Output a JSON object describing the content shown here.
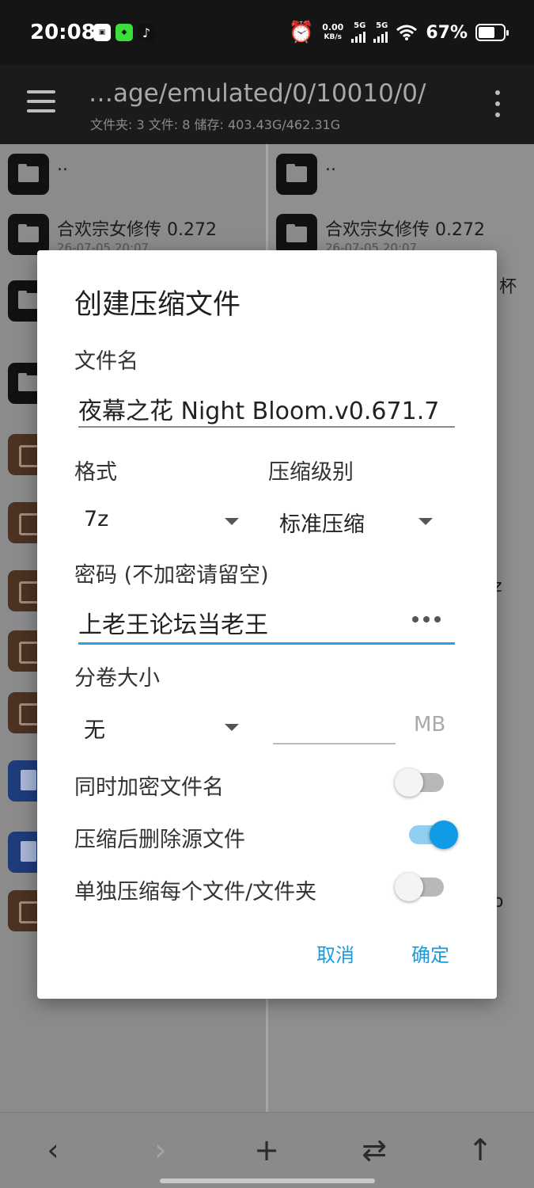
{
  "status_bar": {
    "time": "20:08",
    "app_icons": [
      "app-icon-1",
      "app-icon-2",
      "tiktok-icon"
    ],
    "net_speed_value": "0.00",
    "net_speed_unit": "KB/s",
    "signal_1": "5G",
    "signal_2": "5G",
    "battery": "67%",
    "battery_level": 0.67
  },
  "toolbar": {
    "path": "…age/emulated/0/10010/0/",
    "summary": "文件夹: 3  文件: 8  储存: 403.43G/462.31G"
  },
  "left_pane": {
    "items": [
      {
        "type": "folder",
        "name": "..",
        "date": ""
      },
      {
        "type": "folder",
        "name": "合欢宗女修传 0.272",
        "date": "26-07-05 20:07"
      },
      {
        "type": "folder",
        "name": "",
        "date": ""
      },
      {
        "type": "folder",
        "name": "",
        "date": ""
      },
      {
        "type": "archive",
        "name": "",
        "date": ""
      },
      {
        "type": "archive",
        "name": "",
        "date": ""
      },
      {
        "type": "archive",
        "name": "",
        "date": ""
      },
      {
        "type": "archive",
        "name": "",
        "date": ""
      },
      {
        "type": "archive",
        "name": "",
        "date": ""
      },
      {
        "type": "doc",
        "name": "",
        "date": ""
      },
      {
        "type": "doc",
        "name": "",
        "date": ""
      },
      {
        "type": "archive",
        "name": "",
        "date": ""
      }
    ]
  },
  "right_pane": {
    "items": [
      {
        "type": "folder",
        "name": "..",
        "date": ""
      },
      {
        "type": "folder",
        "name": "合欢宗女修传 0.272",
        "date": "26-07-05 20:07"
      }
    ],
    "peek_1": "杯",
    "peek_2": "z",
    "peek_3": "o"
  },
  "dialog": {
    "title": "创建压缩文件",
    "filename_label": "文件名",
    "filename_value": "夜幕之花 Night Bloom.v0.671.7",
    "format_label": "格式",
    "format_value": "7z",
    "level_label": "压缩级别",
    "level_value": "标准压缩",
    "password_label": "密码 (不加密请留空)",
    "password_value": "上老王论坛当老王",
    "volume_label": "分卷大小",
    "volume_value": "无",
    "volume_size_value": "",
    "volume_unit": "MB",
    "options": [
      {
        "label": "同时加密文件名",
        "on": false
      },
      {
        "label": "压缩后删除源文件",
        "on": true
      },
      {
        "label": "单独压缩每个文件/文件夹",
        "on": false
      }
    ],
    "cancel_label": "取消",
    "ok_label": "确定"
  },
  "bottom_bar": {
    "back_icon": "‹",
    "forward_icon": "›",
    "add_icon": "+",
    "swap_icon": "⇄",
    "up_icon": "↑"
  }
}
